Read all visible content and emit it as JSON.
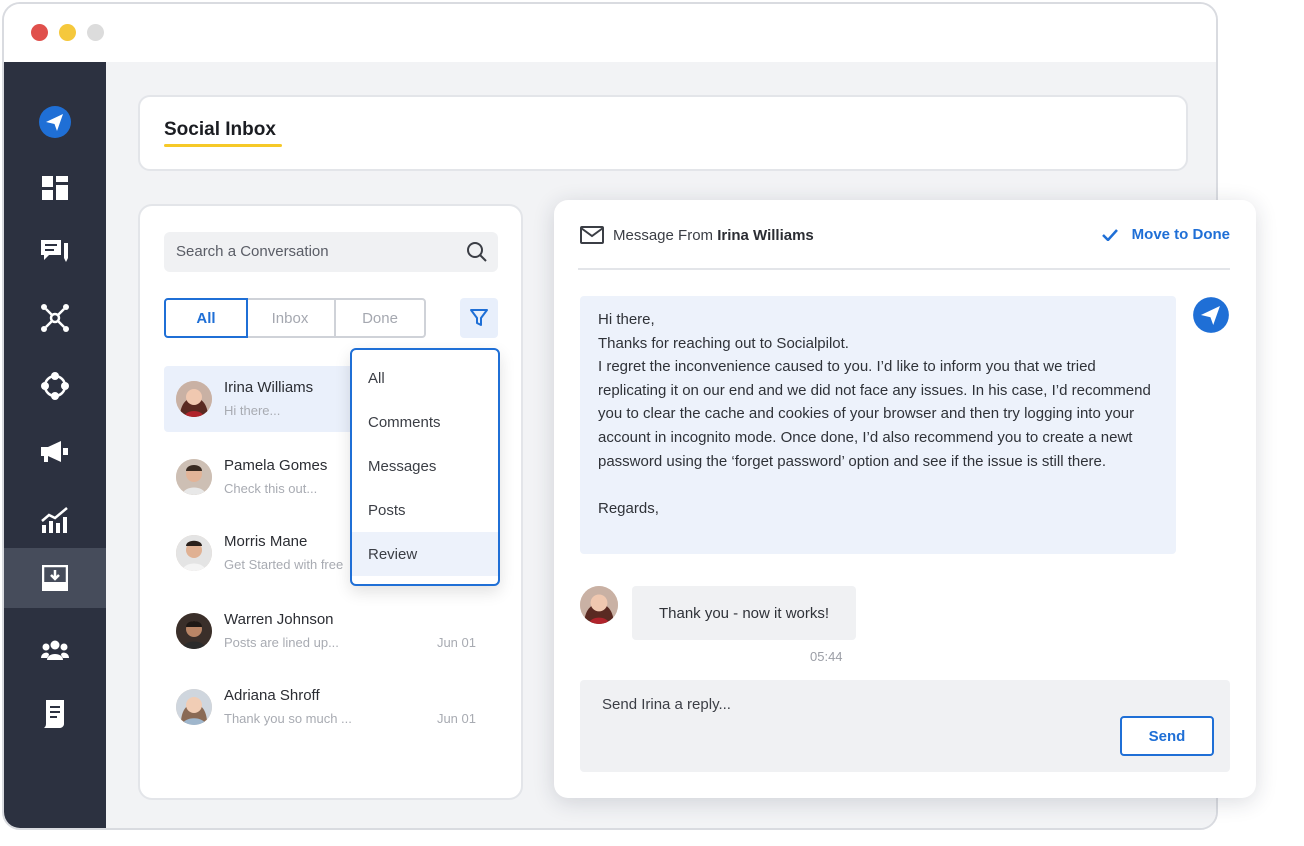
{
  "window": {
    "controls": [
      "close",
      "minimize",
      "maximize"
    ]
  },
  "sidebar": {
    "items": [
      {
        "icon": "paper-plane-logo-icon",
        "active": false
      },
      {
        "icon": "dashboard-grid-icon",
        "active": false
      },
      {
        "icon": "chat-bubble-icon",
        "active": false
      },
      {
        "icon": "network-hub-icon",
        "active": false
      },
      {
        "icon": "connected-nodes-icon",
        "active": false
      },
      {
        "icon": "megaphone-icon",
        "active": false
      },
      {
        "icon": "analytics-chart-icon",
        "active": false
      },
      {
        "icon": "inbox-download-icon",
        "active": true
      },
      {
        "icon": "team-users-icon",
        "active": false
      },
      {
        "icon": "document-list-icon",
        "active": false
      }
    ],
    "colors": {
      "background": "#2c3140",
      "active": "#464c5b"
    }
  },
  "header": {
    "title": "Social Inbox",
    "underline_color": "#f6c928"
  },
  "conversations": {
    "search_placeholder": "Search a Conversation",
    "tabs": [
      {
        "label": "All",
        "active": true
      },
      {
        "label": "Inbox",
        "active": false
      },
      {
        "label": "Done",
        "active": false
      }
    ],
    "filter_menu": {
      "open": true,
      "options": [
        "All",
        "Comments",
        "Messages",
        "Posts",
        "Review"
      ],
      "highlighted": "Review"
    },
    "items": [
      {
        "name": "Irina Williams",
        "preview": "Hi there...",
        "date": "",
        "selected": true
      },
      {
        "name": "Pamela Gomes",
        "preview": "Check this out...",
        "date": "",
        "selected": false
      },
      {
        "name": "Morris Mane",
        "preview": "Get Started with free",
        "date": "",
        "selected": false
      },
      {
        "name": "Warren Johnson",
        "preview": "Posts are lined up...",
        "date": "Jun 01",
        "selected": false
      },
      {
        "name": "Adriana Shroff",
        "preview": "Thank you so much ...",
        "date": "Jun 01",
        "selected": false
      }
    ]
  },
  "message_panel": {
    "header_prefix": "Message From",
    "sender": "Irina Williams",
    "move_to_done": "Move to Done",
    "outgoing_message": [
      "Hi there,",
      "Thanks for reaching out to Socialpilot.",
      "I regret the inconvenience caused to you. I’d like to inform you that we tried replicating it on our end and we did not face any issues. In his case, I’d recommend you to clear the cache and cookies of your browser and then try logging into your account in incognito mode. Once done, I’d also recommend you to create a newt password using the ‘forget password’ option and see if the issue is still there.",
      "",
      "Regards,"
    ],
    "incoming_message": "Thank you - now it works!",
    "incoming_time": "05:44",
    "reply_placeholder": "Send Irina a reply...",
    "send_label": "Send"
  },
  "colors": {
    "accent": "#1f6fd6",
    "highlight": "#edf2fb"
  }
}
